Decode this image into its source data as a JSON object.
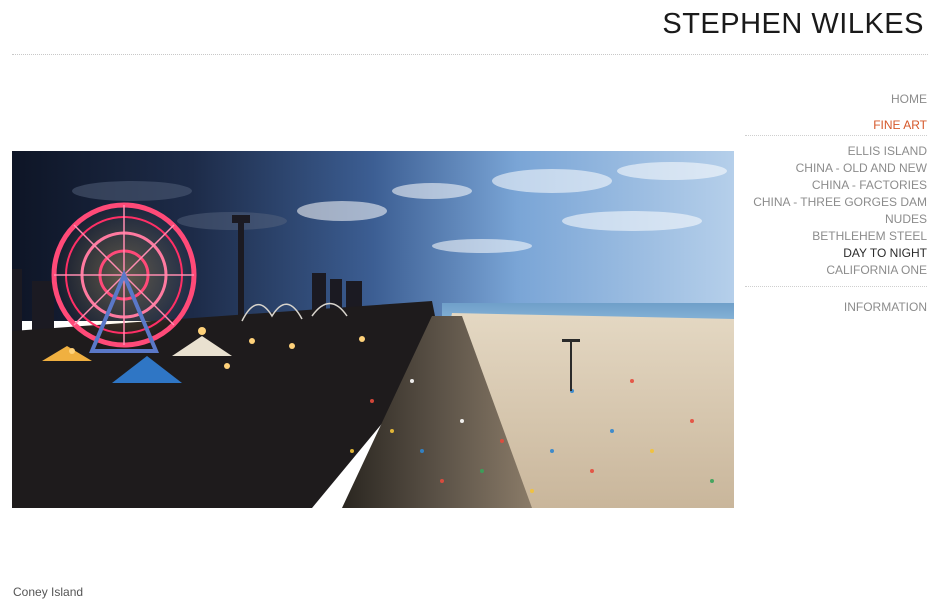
{
  "site": {
    "title": "STEPHEN WILKES"
  },
  "nav": {
    "home": "HOME",
    "fine_art": "FINE ART",
    "items": [
      {
        "label": "ELLIS ISLAND"
      },
      {
        "label": "CHINA - OLD AND NEW"
      },
      {
        "label": "CHINA - FACTORIES"
      },
      {
        "label": "CHINA - THREE GORGES DAM"
      },
      {
        "label": "NUDES"
      },
      {
        "label": "BETHLEHEM STEEL"
      },
      {
        "label": "DAY TO NIGHT"
      },
      {
        "label": "CALIFORNIA ONE"
      }
    ],
    "information": "INFORMATION"
  },
  "colors": {
    "accent": "#d5582a",
    "nav_text": "#8c8c8c",
    "active": "#2b2b2b"
  },
  "photo": {
    "caption": "Coney Island"
  }
}
